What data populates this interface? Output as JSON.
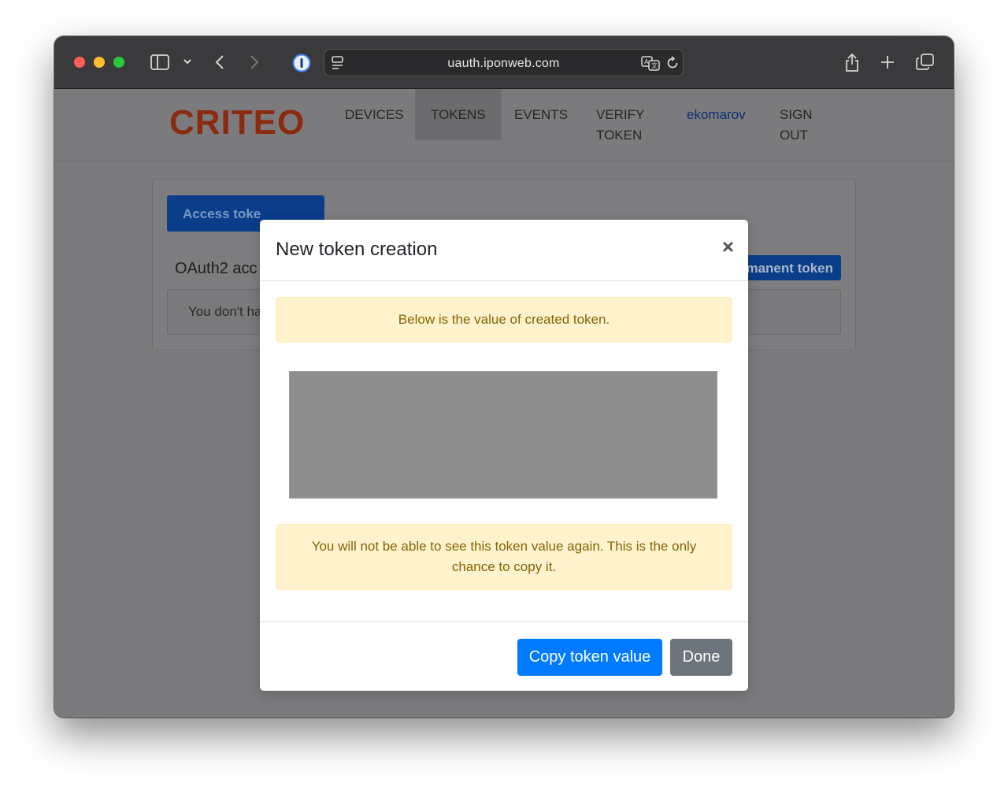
{
  "browser": {
    "url": "uauth.iponweb.com"
  },
  "nav": {
    "logo": "CRITEO",
    "items": [
      {
        "label": "DEVICES"
      },
      {
        "label": "TOKENS"
      },
      {
        "label": "EVENTS"
      },
      {
        "label": "VERIFY TOKEN"
      }
    ],
    "user": "ekomarov",
    "sign_out": "SIGN OUT"
  },
  "background": {
    "tab_button": "Access toke",
    "heading": "OAuth2 acc",
    "permanent_button": "rmanent token",
    "empty_message": "You don't ha"
  },
  "modal": {
    "title": "New token creation",
    "close": "×",
    "info_message": "Below is the value of created token.",
    "warning_message": "You will not be able to see this token value again. This is the only chance to copy it.",
    "copy_button": "Copy token value",
    "done_button": "Done"
  }
}
